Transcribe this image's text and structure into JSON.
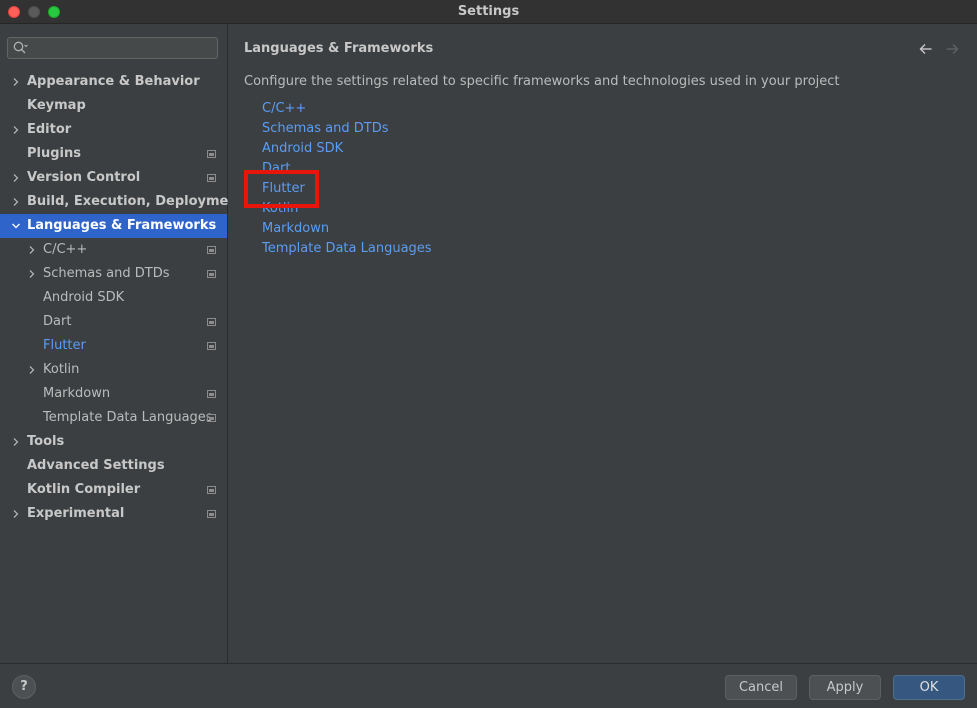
{
  "window": {
    "title": "Settings"
  },
  "search": {
    "placeholder": "",
    "value": ""
  },
  "sidebar": {
    "items": [
      {
        "label": "Appearance & Behavior",
        "level": 0,
        "expandable": true,
        "project_icon": false
      },
      {
        "label": "Keymap",
        "level": 0,
        "expandable": false,
        "project_icon": false
      },
      {
        "label": "Editor",
        "level": 0,
        "expandable": true,
        "project_icon": false
      },
      {
        "label": "Plugins",
        "level": 0,
        "expandable": false,
        "project_icon": true
      },
      {
        "label": "Version Control",
        "level": 0,
        "expandable": true,
        "project_icon": true
      },
      {
        "label": "Build, Execution, Deployment",
        "level": 0,
        "expandable": true,
        "project_icon": false
      },
      {
        "label": "Languages & Frameworks",
        "level": 0,
        "expandable": true,
        "expanded": true,
        "selected": true,
        "project_icon": false
      },
      {
        "label": "C/C++",
        "level": 1,
        "expandable": true,
        "project_icon": true
      },
      {
        "label": "Schemas and DTDs",
        "level": 1,
        "expandable": true,
        "project_icon": true
      },
      {
        "label": "Android SDK",
        "level": 1,
        "expandable": false,
        "project_icon": false
      },
      {
        "label": "Dart",
        "level": 1,
        "expandable": false,
        "project_icon": true
      },
      {
        "label": "Flutter",
        "level": 1,
        "expandable": false,
        "active": true,
        "project_icon": true
      },
      {
        "label": "Kotlin",
        "level": 1,
        "expandable": true,
        "project_icon": false
      },
      {
        "label": "Markdown",
        "level": 1,
        "expandable": false,
        "project_icon": true
      },
      {
        "label": "Template Data Languages",
        "level": 1,
        "expandable": false,
        "project_icon": true
      },
      {
        "label": "Tools",
        "level": 0,
        "expandable": true,
        "project_icon": false
      },
      {
        "label": "Advanced Settings",
        "level": 0,
        "expandable": false,
        "project_icon": false
      },
      {
        "label": "Kotlin Compiler",
        "level": 0,
        "expandable": false,
        "project_icon": true
      },
      {
        "label": "Experimental",
        "level": 0,
        "expandable": true,
        "project_icon": true
      }
    ]
  },
  "content": {
    "title": "Languages & Frameworks",
    "description": "Configure the settings related to specific frameworks and technologies used in your project",
    "links": [
      "C/C++",
      "Schemas and DTDs",
      "Android SDK",
      "Dart",
      "Flutter",
      "Kotlin",
      "Markdown",
      "Template Data Languages"
    ]
  },
  "footer": {
    "help_label": "?",
    "cancel_label": "Cancel",
    "apply_label": "Apply",
    "ok_label": "OK"
  },
  "colors": {
    "selection": "#2f65ca",
    "link": "#589df6",
    "highlight": "#e8150b"
  }
}
